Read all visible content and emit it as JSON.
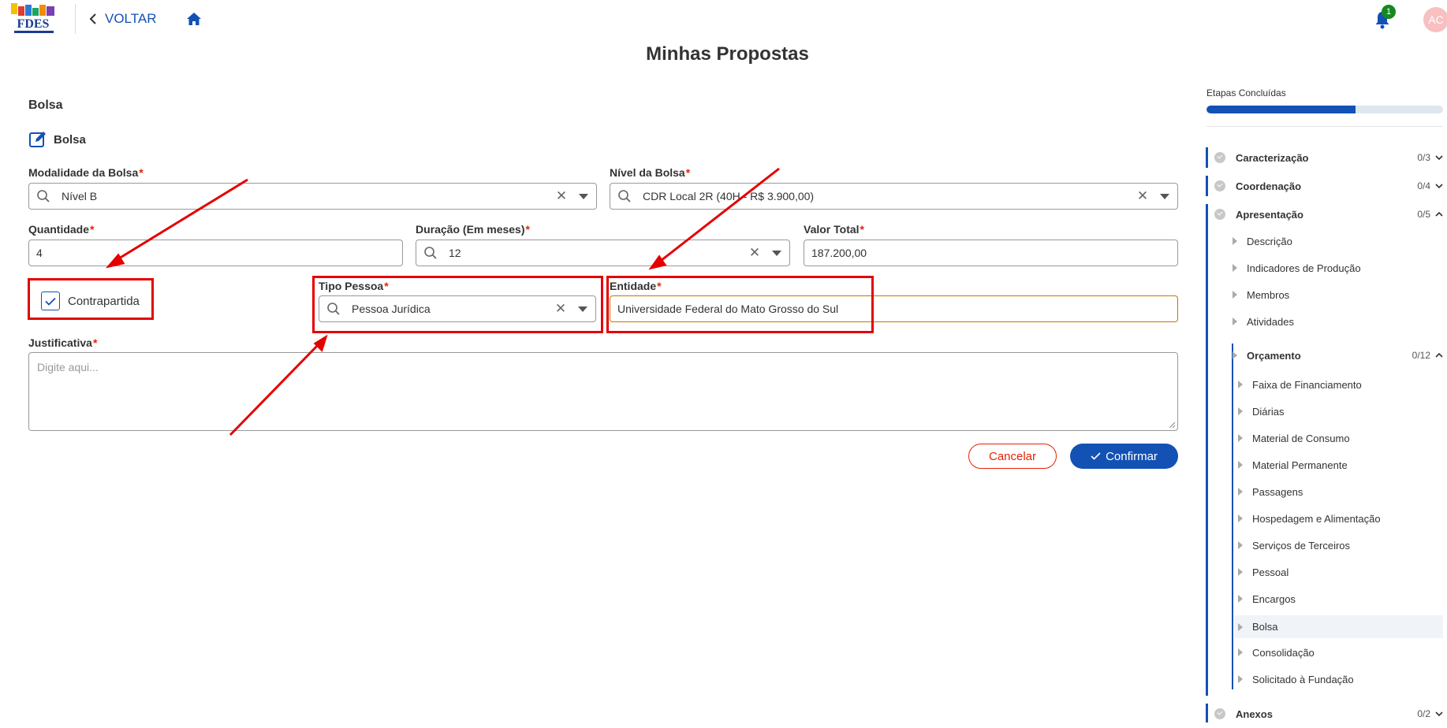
{
  "header": {
    "logo_alt": "FDES",
    "back_label": "VOLTAR",
    "notification_count": "1",
    "avatar_initials": "AC"
  },
  "page": {
    "title": "Minhas Propostas",
    "section_title": "Bolsa",
    "sub_title": "Bolsa"
  },
  "form": {
    "modalidade": {
      "label": "Modalidade da Bolsa",
      "value": "Nível B"
    },
    "nivel": {
      "label": "Nível da Bolsa",
      "value": "CDR Local 2R (40H - R$ 3.900,00)"
    },
    "quantidade": {
      "label": "Quantidade",
      "value": "4"
    },
    "duracao": {
      "label": "Duração (Em meses)",
      "value": "12"
    },
    "valor_total": {
      "label": "Valor Total",
      "value": "187.200,00"
    },
    "contrapartida": {
      "label": "Contrapartida",
      "checked": true
    },
    "tipo_pessoa": {
      "label": "Tipo Pessoa",
      "value": "Pessoa Jurídica"
    },
    "entidade": {
      "label": "Entidade",
      "value": "Universidade Federal do Mato Grosso do Sul"
    },
    "justificativa": {
      "label": "Justificativa",
      "placeholder": "Digite aqui..."
    },
    "required_mark": "*",
    "cancel_label": "Cancelar",
    "confirm_label": "Confirmar"
  },
  "progress": {
    "label": "Etapas Concluídas",
    "fraction": 0.63
  },
  "steps": [
    {
      "label": "Caracterização",
      "count": "0/3",
      "expanded": false
    },
    {
      "label": "Coordenação",
      "count": "0/4",
      "expanded": false
    },
    {
      "label": "Apresentação",
      "count": "0/5",
      "expanded": true
    },
    {
      "label": "Anexos",
      "count": "0/2",
      "expanded": false
    }
  ],
  "apresentacao_items": [
    "Descrição",
    "Indicadores de Produção",
    "Membros",
    "Atividades"
  ],
  "orcamento": {
    "label": "Orçamento",
    "count": "0/12",
    "items": [
      "Faixa de Financiamento",
      "Diárias",
      "Material de Consumo",
      "Material Permanente",
      "Passagens",
      "Hospedagem e Alimentação",
      "Serviços de Terceiros",
      "Pessoal",
      "Encargos",
      "Bolsa",
      "Consolidação",
      "Solicitado à Fundação"
    ],
    "active": "Bolsa"
  },
  "colors": {
    "primary": "#1351b4",
    "danger": "#e52207",
    "annotation": "#e50000",
    "focus": "#c77700"
  }
}
